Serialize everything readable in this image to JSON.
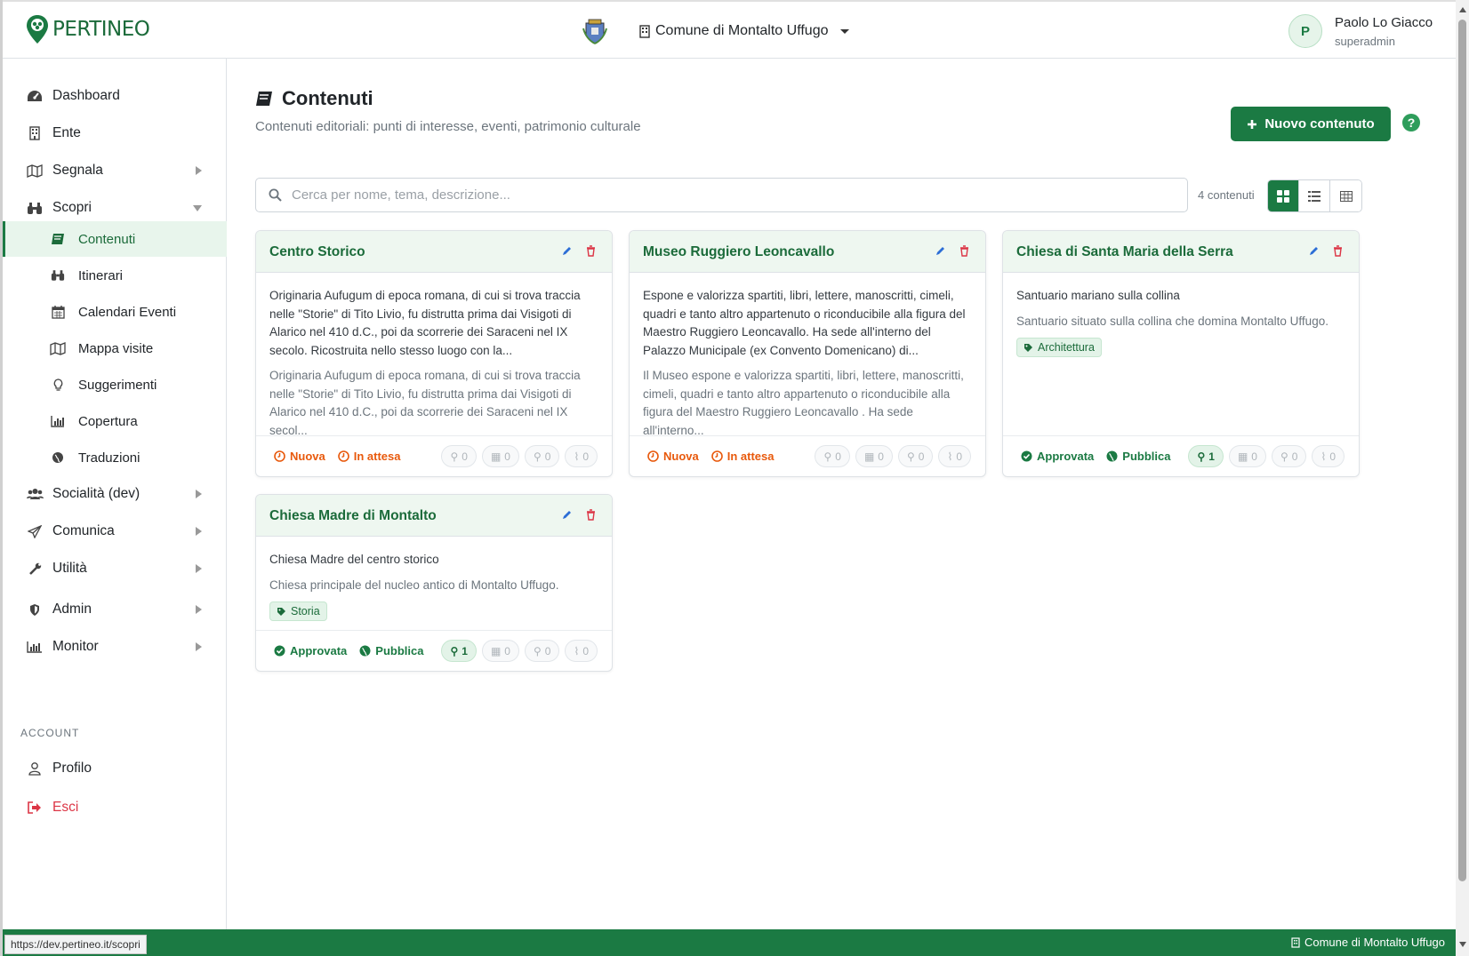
{
  "header": {
    "brand": "PERTINEO",
    "entity": "Comune di Montalto Uffugo",
    "user_initial": "P",
    "user_name": "Paolo Lo Giacco",
    "user_role": "superadmin"
  },
  "sidebar": {
    "items": [
      {
        "label": "Dashboard",
        "icon": "dashboard-icon"
      },
      {
        "label": "Ente",
        "icon": "building-icon"
      },
      {
        "label": "Segnala",
        "icon": "map-icon"
      },
      {
        "label": "Scopri",
        "icon": "binoculars-icon"
      },
      {
        "label": "Socialità (dev)",
        "icon": "users-icon"
      },
      {
        "label": "Comunica",
        "icon": "paper-plane-icon"
      },
      {
        "label": "Utilità",
        "icon": "wrench-icon"
      },
      {
        "label": "Admin",
        "icon": "shield-icon"
      },
      {
        "label": "Monitor",
        "icon": "bar-chart-icon"
      }
    ],
    "subitems": [
      {
        "label": "Contenuti",
        "icon": "book-icon"
      },
      {
        "label": "Itinerari",
        "icon": "binoculars-icon"
      },
      {
        "label": "Calendari Eventi",
        "icon": "calendar-icon"
      },
      {
        "label": "Mappa visite",
        "icon": "map-icon"
      },
      {
        "label": "Suggerimenti",
        "icon": "lightbulb-icon"
      },
      {
        "label": "Copertura",
        "icon": "bar-chart-icon"
      },
      {
        "label": "Traduzioni",
        "icon": "globe-icon"
      }
    ],
    "account_label": "ACCOUNT",
    "profile": "Profilo",
    "logout": "Esci"
  },
  "main": {
    "title": "Contenuti",
    "subtitle": "Contenuti editoriali: punti di interesse, eventi, patrimonio culturale",
    "new_button": "Nuovo contenuto",
    "help": "?",
    "search_placeholder": "Cerca per nome, tema, descrizione...",
    "count": "4 contenuti"
  },
  "cards": [
    {
      "title": "Centro Storico",
      "desc": "Originaria Aufugum di epoca romana, di cui si trova traccia nelle \"Storie\" di Tito Livio, fu distrutta prima dai Visigoti di Alarico nel 410 d.C., poi da scorrerie dei Saraceni nel IX secolo. Ricostruita nello stesso luogo con la...",
      "desc2": "Originaria Aufugum di epoca romana, di cui si trova traccia nelle \"Storie\" di Tito Livio, fu distrutta prima dai Visigoti di Alarico nel 410 d.C., poi da scorrerie dei Saraceni nel IX secol...",
      "status1": "Nuova",
      "status2": "In attesa",
      "pills": [
        "0",
        "0",
        "0",
        "0"
      ]
    },
    {
      "title": "Museo Ruggiero Leoncavallo",
      "desc": "Espone e valorizza spartiti, libri, lettere, manoscritti, cimeli, quadri e tanto altro appartenuto o riconducibile alla figura del Maestro Ruggiero Leoncavallo. Ha sede all'interno del Palazzo Municipale (ex Convento Domenicano) di...",
      "desc2": "Il Museo espone e valorizza spartiti, libri, lettere, manoscritti, cimeli, quadri e tanto altro appartenuto o riconducibile alla figura del Maestro Ruggiero Leoncavallo . Ha sede all'interno...",
      "status1": "Nuova",
      "status2": "In attesa",
      "pills": [
        "0",
        "0",
        "0",
        "0"
      ]
    },
    {
      "title": "Chiesa di Santa Maria della Serra",
      "desc": "Santuario mariano sulla collina",
      "desc2": "Santuario situato sulla collina che domina Montalto Uffugo.",
      "tag": "Architettura",
      "status1": "Approvata",
      "status2": "Pubblica",
      "pills": [
        "1",
        "0",
        "0",
        "0"
      ]
    },
    {
      "title": "Chiesa Madre di Montalto",
      "desc": "Chiesa Madre del centro storico",
      "desc2": "Chiesa principale del nucleo antico di Montalto Uffugo.",
      "tag": "Storia",
      "status1": "Approvata",
      "status2": "Pubblica",
      "pills": [
        "1",
        "0",
        "0",
        "0"
      ]
    }
  ],
  "footer": {
    "entity": "Comune di Montalto Uffugo",
    "status_url": "https://dev.pertineo.it/scopri"
  },
  "colors": {
    "accent": "#1b7a43",
    "warning": "#e8590c",
    "danger": "#dc3545",
    "edit": "#2c6ed6"
  }
}
